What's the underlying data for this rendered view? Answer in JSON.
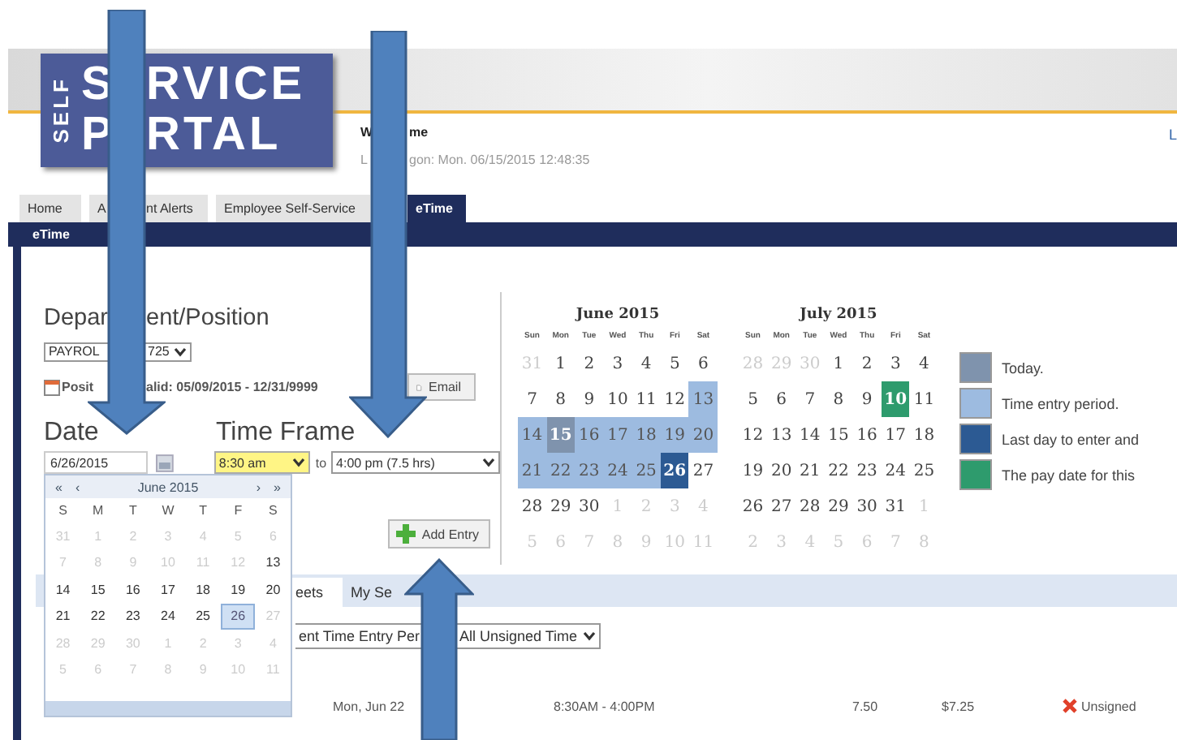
{
  "header": {
    "logo": {
      "side": "SELF",
      "line1": [
        "S",
        "RVICE"
      ],
      "line2": [
        "P",
        "RTAL"
      ]
    },
    "welcome": [
      "W",
      "me"
    ],
    "last_logon": [
      "L",
      "gon: Mon. 06/15/2015 12:48:35"
    ],
    "corner_link": "L"
  },
  "tabs": [
    {
      "parts": [
        "Home"
      ],
      "selected": false
    },
    {
      "parts": [
        "A",
        "nt Alerts"
      ],
      "selected": false
    },
    {
      "parts": [
        "Employee Self-Service"
      ],
      "selected": false
    },
    {
      "parts": [
        "eTime"
      ],
      "selected": true
    }
  ],
  "subnav": "eTime",
  "form": {
    "department_label": [
      "Depar",
      "ent/Position"
    ],
    "department_select": [
      "PAYROL",
      "725"
    ],
    "position_valid": [
      "Posit",
      "alid: 05/09/2015 - 12/31/9999"
    ],
    "email_button": "Email",
    "date_label": "Date",
    "date_value": "6/26/2015",
    "time_frame_label": "Time Frame",
    "start_time": "8:30 am",
    "to": "to",
    "end_time": "4:00 pm (7.5 hrs)",
    "add_entry": "Add Entry"
  },
  "date_picker": {
    "nav_prev": [
      "«",
      "‹"
    ],
    "title": "June 2015",
    "nav_next": [
      "›",
      "»"
    ],
    "weekdays": [
      "S",
      "M",
      "T",
      "W",
      "T",
      "F",
      "S"
    ],
    "weeks": [
      [
        {
          "d": "31",
          "disabled": true,
          "selected": false
        },
        {
          "d": "1",
          "disabled": true,
          "selected": false
        },
        {
          "d": "2",
          "disabled": true,
          "selected": false
        },
        {
          "d": "3",
          "disabled": true,
          "selected": false
        },
        {
          "d": "4",
          "disabled": true,
          "selected": false
        },
        {
          "d": "5",
          "disabled": true,
          "selected": false
        },
        {
          "d": "6",
          "disabled": true,
          "selected": false
        }
      ],
      [
        {
          "d": "7",
          "disabled": true,
          "selected": false
        },
        {
          "d": "8",
          "disabled": true,
          "selected": false
        },
        {
          "d": "9",
          "disabled": true,
          "selected": false
        },
        {
          "d": "10",
          "disabled": true,
          "selected": false
        },
        {
          "d": "11",
          "disabled": true,
          "selected": false
        },
        {
          "d": "12",
          "disabled": true,
          "selected": false
        },
        {
          "d": "13",
          "disabled": false,
          "selected": false
        }
      ],
      [
        {
          "d": "14",
          "disabled": false,
          "selected": false
        },
        {
          "d": "15",
          "disabled": false,
          "selected": false
        },
        {
          "d": "16",
          "disabled": false,
          "selected": false
        },
        {
          "d": "17",
          "disabled": false,
          "selected": false
        },
        {
          "d": "18",
          "disabled": false,
          "selected": false
        },
        {
          "d": "19",
          "disabled": false,
          "selected": false
        },
        {
          "d": "20",
          "disabled": false,
          "selected": false
        }
      ],
      [
        {
          "d": "21",
          "disabled": false,
          "selected": false
        },
        {
          "d": "22",
          "disabled": false,
          "selected": false
        },
        {
          "d": "23",
          "disabled": false,
          "selected": false
        },
        {
          "d": "24",
          "disabled": false,
          "selected": false
        },
        {
          "d": "25",
          "disabled": false,
          "selected": false
        },
        {
          "d": "26",
          "disabled": false,
          "selected": true
        },
        {
          "d": "27",
          "disabled": true,
          "selected": false
        }
      ],
      [
        {
          "d": "28",
          "disabled": true,
          "selected": false
        },
        {
          "d": "29",
          "disabled": true,
          "selected": false
        },
        {
          "d": "30",
          "disabled": true,
          "selected": false
        },
        {
          "d": "1",
          "disabled": true,
          "selected": false
        },
        {
          "d": "2",
          "disabled": true,
          "selected": false
        },
        {
          "d": "3",
          "disabled": true,
          "selected": false
        },
        {
          "d": "4",
          "disabled": true,
          "selected": false
        }
      ],
      [
        {
          "d": "5",
          "disabled": true,
          "selected": false
        },
        {
          "d": "6",
          "disabled": true,
          "selected": false
        },
        {
          "d": "7",
          "disabled": true,
          "selected": false
        },
        {
          "d": "8",
          "disabled": true,
          "selected": false
        },
        {
          "d": "9",
          "disabled": true,
          "selected": false
        },
        {
          "d": "10",
          "disabled": true,
          "selected": false
        },
        {
          "d": "11",
          "disabled": true,
          "selected": false
        }
      ]
    ]
  },
  "calendars": [
    {
      "title": "June 2015",
      "weekdays": [
        "Sun",
        "Mon",
        "Tue",
        "Wed",
        "Thu",
        "Fri",
        "Sat"
      ],
      "weeks": [
        [
          {
            "d": "31",
            "kind": "other"
          },
          {
            "d": "1",
            "kind": "normal"
          },
          {
            "d": "2",
            "kind": "normal"
          },
          {
            "d": "3",
            "kind": "normal"
          },
          {
            "d": "4",
            "kind": "normal"
          },
          {
            "d": "5",
            "kind": "normal"
          },
          {
            "d": "6",
            "kind": "normal"
          }
        ],
        [
          {
            "d": "7",
            "kind": "normal"
          },
          {
            "d": "8",
            "kind": "normal"
          },
          {
            "d": "9",
            "kind": "normal"
          },
          {
            "d": "10",
            "kind": "normal"
          },
          {
            "d": "11",
            "kind": "normal"
          },
          {
            "d": "12",
            "kind": "normal"
          },
          {
            "d": "13",
            "kind": "period"
          }
        ],
        [
          {
            "d": "14",
            "kind": "period"
          },
          {
            "d": "15",
            "kind": "today"
          },
          {
            "d": "16",
            "kind": "period"
          },
          {
            "d": "17",
            "kind": "period"
          },
          {
            "d": "18",
            "kind": "period"
          },
          {
            "d": "19",
            "kind": "period"
          },
          {
            "d": "20",
            "kind": "period"
          }
        ],
        [
          {
            "d": "21",
            "kind": "period"
          },
          {
            "d": "22",
            "kind": "period"
          },
          {
            "d": "23",
            "kind": "period"
          },
          {
            "d": "24",
            "kind": "period"
          },
          {
            "d": "25",
            "kind": "period"
          },
          {
            "d": "26",
            "kind": "last"
          },
          {
            "d": "27",
            "kind": "normal"
          }
        ],
        [
          {
            "d": "28",
            "kind": "normal"
          },
          {
            "d": "29",
            "kind": "normal"
          },
          {
            "d": "30",
            "kind": "normal"
          },
          {
            "d": "1",
            "kind": "other"
          },
          {
            "d": "2",
            "kind": "other"
          },
          {
            "d": "3",
            "kind": "other"
          },
          {
            "d": "4",
            "kind": "other"
          }
        ],
        [
          {
            "d": "5",
            "kind": "other"
          },
          {
            "d": "6",
            "kind": "other"
          },
          {
            "d": "7",
            "kind": "other"
          },
          {
            "d": "8",
            "kind": "other"
          },
          {
            "d": "9",
            "kind": "other"
          },
          {
            "d": "10",
            "kind": "other"
          },
          {
            "d": "11",
            "kind": "other"
          }
        ]
      ]
    },
    {
      "title": "July 2015",
      "weekdays": [
        "Sun",
        "Mon",
        "Tue",
        "Wed",
        "Thu",
        "Fri",
        "Sat"
      ],
      "weeks": [
        [
          {
            "d": "28",
            "kind": "other"
          },
          {
            "d": "29",
            "kind": "other"
          },
          {
            "d": "30",
            "kind": "other"
          },
          {
            "d": "1",
            "kind": "normal"
          },
          {
            "d": "2",
            "kind": "normal"
          },
          {
            "d": "3",
            "kind": "normal"
          },
          {
            "d": "4",
            "kind": "normal"
          }
        ],
        [
          {
            "d": "5",
            "kind": "normal"
          },
          {
            "d": "6",
            "kind": "normal"
          },
          {
            "d": "7",
            "kind": "normal"
          },
          {
            "d": "8",
            "kind": "normal"
          },
          {
            "d": "9",
            "kind": "normal"
          },
          {
            "d": "10",
            "kind": "payday"
          },
          {
            "d": "11",
            "kind": "normal"
          }
        ],
        [
          {
            "d": "12",
            "kind": "normal"
          },
          {
            "d": "13",
            "kind": "normal"
          },
          {
            "d": "14",
            "kind": "normal"
          },
          {
            "d": "15",
            "kind": "normal"
          },
          {
            "d": "16",
            "kind": "normal"
          },
          {
            "d": "17",
            "kind": "normal"
          },
          {
            "d": "18",
            "kind": "normal"
          }
        ],
        [
          {
            "d": "19",
            "kind": "normal"
          },
          {
            "d": "20",
            "kind": "normal"
          },
          {
            "d": "21",
            "kind": "normal"
          },
          {
            "d": "22",
            "kind": "normal"
          },
          {
            "d": "23",
            "kind": "normal"
          },
          {
            "d": "24",
            "kind": "normal"
          },
          {
            "d": "25",
            "kind": "normal"
          }
        ],
        [
          {
            "d": "26",
            "kind": "normal"
          },
          {
            "d": "27",
            "kind": "normal"
          },
          {
            "d": "28",
            "kind": "normal"
          },
          {
            "d": "29",
            "kind": "normal"
          },
          {
            "d": "30",
            "kind": "normal"
          },
          {
            "d": "31",
            "kind": "normal"
          },
          {
            "d": "1",
            "kind": "other"
          }
        ],
        [
          {
            "d": "2",
            "kind": "other"
          },
          {
            "d": "3",
            "kind": "other"
          },
          {
            "d": "4",
            "kind": "other"
          },
          {
            "d": "5",
            "kind": "other"
          },
          {
            "d": "6",
            "kind": "other"
          },
          {
            "d": "7",
            "kind": "other"
          },
          {
            "d": "8",
            "kind": "other"
          }
        ]
      ]
    }
  ],
  "legend": [
    {
      "color": "#7f93ad",
      "label": "Today."
    },
    {
      "color": "#9dbbe0",
      "label": "Time entry period."
    },
    {
      "color": "#2c5a93",
      "label": "Last day to enter and"
    },
    {
      "color": "#2e9b6d",
      "label": "The pay date for this"
    }
  ],
  "timesheet_tabs": [
    {
      "label": "eets",
      "selected": true
    },
    {
      "label": "My Se",
      "selected": false
    }
  ],
  "period_select": [
    "ent Time Entry Per",
    "All Unsigned Time"
  ],
  "rows": [
    {
      "date": "Mon, Jun 22",
      "time": "8:30AM - 4:00PM",
      "hours": "7.50",
      "rate": "$7.25",
      "status": "Unsigned",
      "signed": false
    }
  ]
}
